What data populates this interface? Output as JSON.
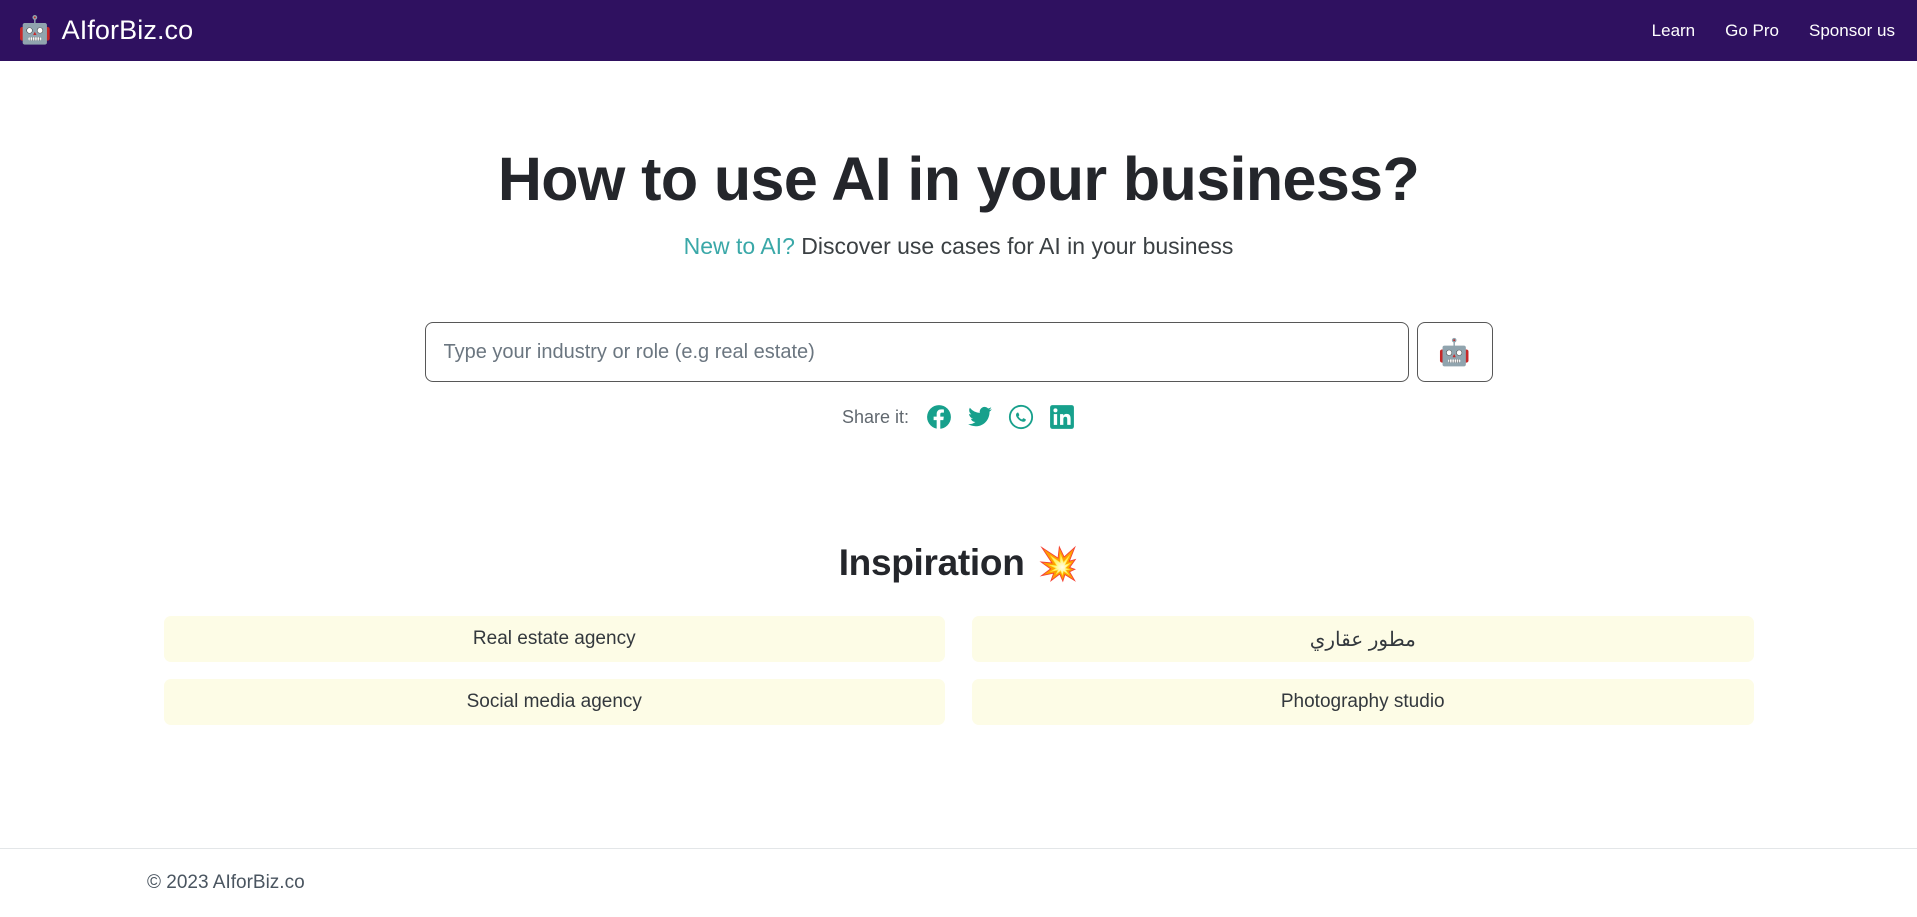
{
  "header": {
    "logo_icon": "robot-emoji",
    "logo_glyph": "🤖",
    "brand_name": "AIforBiz.co",
    "brand_color": "#2F1160",
    "nav": [
      {
        "label": "Learn"
      },
      {
        "label": "Go Pro"
      },
      {
        "label": "Sponsor us"
      }
    ]
  },
  "hero": {
    "title": "How to use AI in your business?",
    "subtitle_link": "New to AI?",
    "subtitle_rest": " Discover use cases for AI in your business",
    "link_color": "#3AA8A8"
  },
  "search": {
    "value": "",
    "placeholder": "Type your industry or role (e.g real estate)",
    "submit_icon": "robot-emoji",
    "submit_glyph": "🤖"
  },
  "share": {
    "label": "Share it:",
    "accent_color": "#17A08C",
    "items": [
      {
        "icon": "facebook-icon",
        "name": "Facebook"
      },
      {
        "icon": "twitter-icon",
        "name": "Twitter"
      },
      {
        "icon": "whatsapp-icon",
        "name": "WhatsApp"
      },
      {
        "icon": "linkedin-icon",
        "name": "LinkedIn"
      }
    ]
  },
  "inspiration": {
    "title": "Inspiration",
    "emoji_icon": "collision-emoji",
    "emoji_glyph": "💥",
    "card_bg": "#FDFCE6",
    "cards": [
      {
        "label": "Real estate agency",
        "dir": "ltr"
      },
      {
        "label": "مطور عقاري",
        "dir": "rtl"
      },
      {
        "label": "Social media agency",
        "dir": "ltr"
      },
      {
        "label": "Photography studio",
        "dir": "ltr"
      }
    ]
  },
  "footer": {
    "copyright": "© 2023 AIforBiz.co"
  }
}
